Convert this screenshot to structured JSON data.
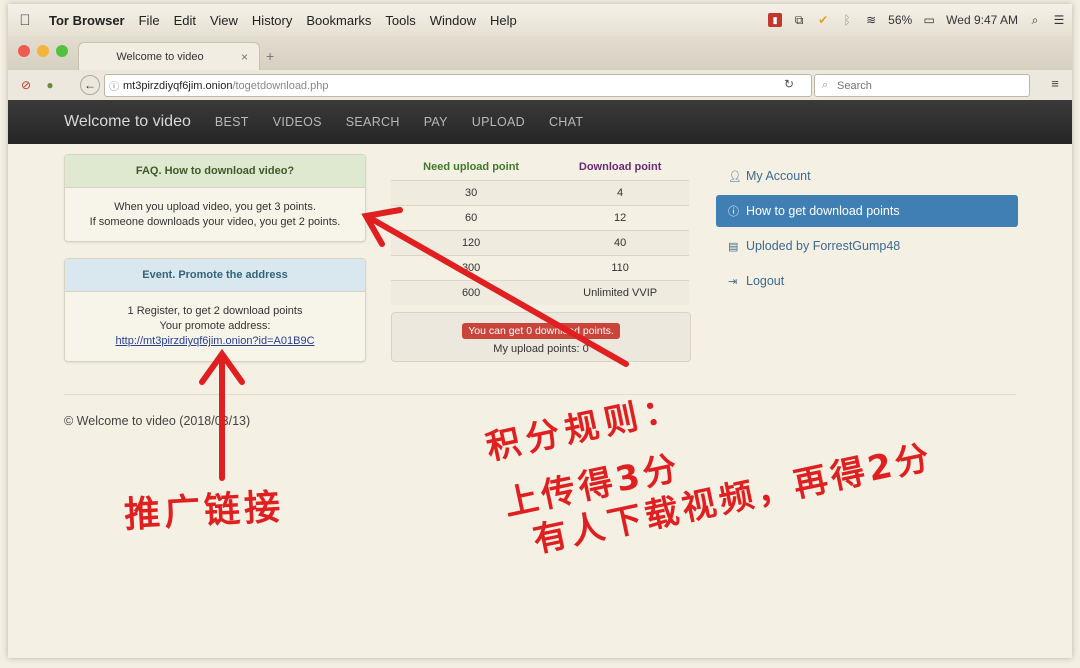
{
  "menubar": {
    "apple": "",
    "app": "Tor Browser",
    "items": [
      "File",
      "Edit",
      "View",
      "History",
      "Bookmarks",
      "Tools",
      "Window",
      "Help"
    ],
    "battery": "56%",
    "clock": "Wed 9:47 AM"
  },
  "browser": {
    "tab_title": "Welcome to video",
    "tab_close": "×",
    "new_tab": "+",
    "url_host": "mt3pirzdiyqf6jim.onion",
    "url_path": "/togetdownload.php",
    "search_placeholder": "Search"
  },
  "site": {
    "brand": "Welcome to video",
    "nav": [
      "BEST",
      "VIDEOS",
      "SEARCH",
      "PAY",
      "UPLOAD",
      "CHAT"
    ]
  },
  "faq": {
    "title": "FAQ. How to download video?",
    "line1": "When you upload video, you get 3 points.",
    "line2": "If someone downloads your video, you get 2 points."
  },
  "event": {
    "title": "Event. Promote the address",
    "line1": "1 Register, to get 2 download points",
    "line2": "Your promote address:",
    "link": "http://mt3pirzdiyqf6jim.onion?id=A01B9C"
  },
  "points_table": {
    "headers": [
      "Need upload point",
      "Download point"
    ],
    "rows": [
      [
        "30",
        "4"
      ],
      [
        "60",
        "12"
      ],
      [
        "120",
        "40"
      ],
      [
        "300",
        "110"
      ],
      [
        "600",
        "Unlimited VVIP"
      ]
    ]
  },
  "current": {
    "badge": "You can get 0 download points.",
    "mine": "My upload points: 0"
  },
  "sidebar": {
    "items": [
      "My Account",
      "How to get download points",
      "Uploded by ForrestGump48",
      "Logout"
    ]
  },
  "footer": {
    "text": "© Welcome to video (2018/03/13)"
  },
  "annotations": {
    "promo": "推广链接",
    "rule_title": "积分规则：",
    "rule1": "上传得3分",
    "rule2": "有人下载视频，再得2分"
  },
  "colors": {
    "annotation_red": "#e02020",
    "active_blue": "#3f7fb4"
  }
}
